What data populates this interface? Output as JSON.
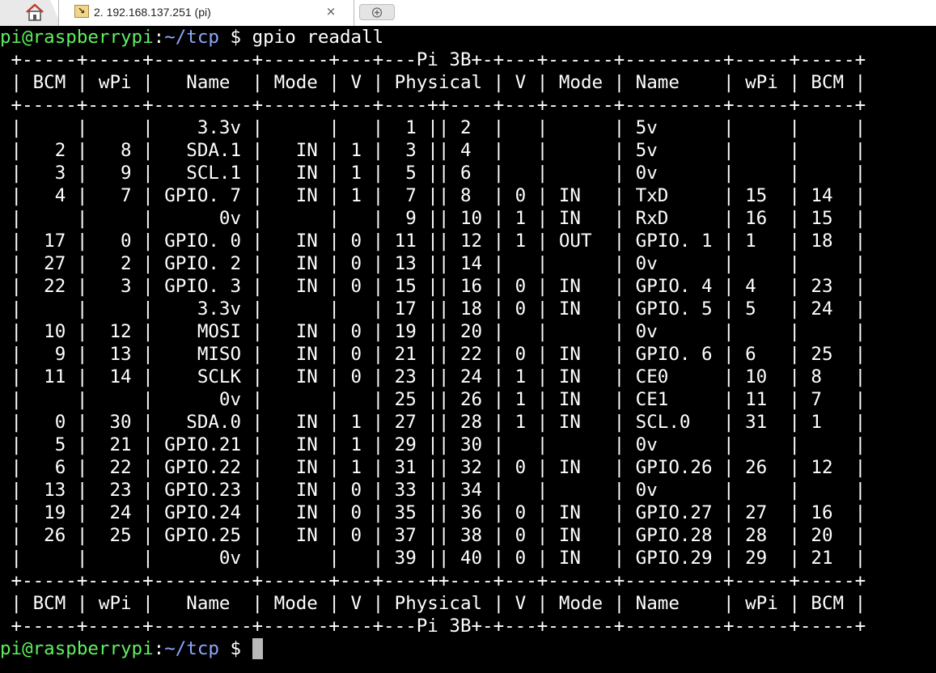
{
  "tabs": {
    "home_icon": "home-icon",
    "active_tab": {
      "icon": "terminal-icon",
      "title": "2. 192.168.137.251 (pi)",
      "close_label": "×"
    },
    "new_tab_icon": "new-tab-icon"
  },
  "colors": {
    "background": "#000000",
    "text": "#ffffff",
    "prompt_user": "#5ff05f",
    "prompt_path": "#8fa8ff",
    "cursor": "#b9b9b9"
  },
  "terminal": {
    "command_prompt": {
      "user": "pi@raspberrypi",
      "colon": ":",
      "path": "~/tcp",
      "symbol": " $ ",
      "command": "gpio readall"
    },
    "output_lines": [
      " +-----+-----+---------+------+---+---Pi 3B+-+---+------+---------+-----+-----+",
      " | BCM | wPi |   Name  | Mode | V | Physical | V | Mode | Name    | wPi | BCM |",
      " +-----+-----+---------+------+---+----++----+---+------+---------+-----+-----+",
      " |     |     |    3.3v |      |   |  1 || 2  |   |      | 5v      |     |     |",
      " |   2 |   8 |   SDA.1 |   IN | 1 |  3 || 4  |   |      | 5v      |     |     |",
      " |   3 |   9 |   SCL.1 |   IN | 1 |  5 || 6  |   |      | 0v      |     |     |",
      " |   4 |   7 | GPIO. 7 |   IN | 1 |  7 || 8  | 0 | IN   | TxD     | 15  | 14  |",
      " |     |     |      0v |      |   |  9 || 10 | 1 | IN   | RxD     | 16  | 15  |",
      " |  17 |   0 | GPIO. 0 |   IN | 0 | 11 || 12 | 1 | OUT  | GPIO. 1 | 1   | 18  |",
      " |  27 |   2 | GPIO. 2 |   IN | 0 | 13 || 14 |   |      | 0v      |     |     |",
      " |  22 |   3 | GPIO. 3 |   IN | 0 | 15 || 16 | 0 | IN   | GPIO. 4 | 4   | 23  |",
      " |     |     |    3.3v |      |   | 17 || 18 | 0 | IN   | GPIO. 5 | 5   | 24  |",
      " |  10 |  12 |    MOSI |   IN | 0 | 19 || 20 |   |      | 0v      |     |     |",
      " |   9 |  13 |    MISO |   IN | 0 | 21 || 22 | 0 | IN   | GPIO. 6 | 6   | 25  |",
      " |  11 |  14 |    SCLK |   IN | 0 | 23 || 24 | 1 | IN   | CE0     | 10  | 8   |",
      " |     |     |      0v |      |   | 25 || 26 | 1 | IN   | CE1     | 11  | 7   |",
      " |   0 |  30 |   SDA.0 |   IN | 1 | 27 || 28 | 1 | IN   | SCL.0   | 31  | 1   |",
      " |   5 |  21 | GPIO.21 |   IN | 1 | 29 || 30 |   |      | 0v      |     |     |",
      " |   6 |  22 | GPIO.22 |   IN | 1 | 31 || 32 | 0 | IN   | GPIO.26 | 26  | 12  |",
      " |  13 |  23 | GPIO.23 |   IN | 0 | 33 || 34 |   |      | 0v      |     |     |",
      " |  19 |  24 | GPIO.24 |   IN | 0 | 35 || 36 | 0 | IN   | GPIO.27 | 27  | 16  |",
      " |  26 |  25 | GPIO.25 |   IN | 0 | 37 || 38 | 0 | IN   | GPIO.28 | 28  | 20  |",
      " |     |     |      0v |      |   | 39 || 40 | 0 | IN   | GPIO.29 | 29  | 21  |",
      " +-----+-----+---------+------+---+----++----+---+------+---------+-----+-----+",
      " | BCM | wPi |   Name  | Mode | V | Physical | V | Mode | Name    | wPi | BCM |",
      " +-----+-----+---------+------+---+---Pi 3B+-+---+------+---------+-----+-----+"
    ],
    "final_prompt": {
      "user": "pi@raspberrypi",
      "colon": ":",
      "path": "~/tcp",
      "symbol": " $ "
    }
  }
}
